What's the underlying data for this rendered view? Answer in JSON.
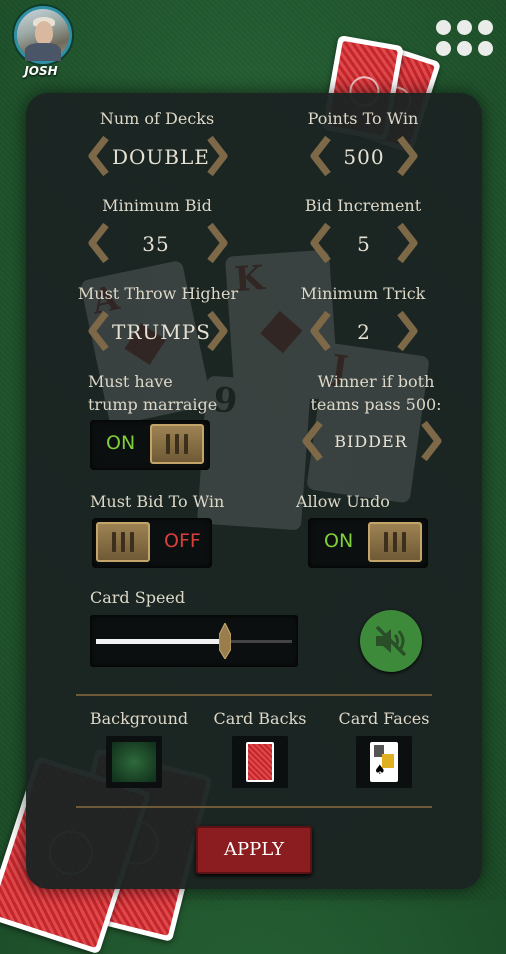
{
  "player": {
    "name": "JOSH"
  },
  "settings": {
    "num_decks": {
      "label": "Num of Decks",
      "value": "DOUBLE"
    },
    "points_to_win": {
      "label": "Points To Win",
      "value": "500"
    },
    "minimum_bid": {
      "label": "Minimum Bid",
      "value": "35"
    },
    "bid_increment": {
      "label": "Bid Increment",
      "value": "5"
    },
    "must_throw_higher": {
      "label": "Must Throw Higher",
      "value": "TRUMPS"
    },
    "minimum_trick": {
      "label": "Minimum Trick",
      "value": "2"
    },
    "trump_marriage": {
      "label_line1": "Must have",
      "label_line2": "trump marraige",
      "state": "ON"
    },
    "winner_both_pass": {
      "label_line1": "Winner if both",
      "label_line2": "teams pass 500:",
      "value": "BIDDER"
    },
    "must_bid_to_win": {
      "label": "Must Bid To Win",
      "state": "OFF"
    },
    "allow_undo": {
      "label": "Allow Undo",
      "state": "ON"
    },
    "card_speed": {
      "label": "Card Speed",
      "level": 0.66
    }
  },
  "appearance": {
    "background_label": "Background",
    "card_backs_label": "Card Backs",
    "card_faces_label": "Card Faces"
  },
  "apply_label": "APPLY",
  "colors": {
    "toggle_on": "#7fcf3a",
    "toggle_off": "#d83f3a",
    "apply_button": "#8b1c1f",
    "mute_button": "#3d8b3a",
    "panel": "#1b2322",
    "felt": "#235a30"
  },
  "icons": {
    "menu": "grid-dots-icon",
    "mute": "speaker-muted-icon",
    "arrow_left": "chevron-left-icon",
    "arrow_right": "chevron-right-icon"
  }
}
